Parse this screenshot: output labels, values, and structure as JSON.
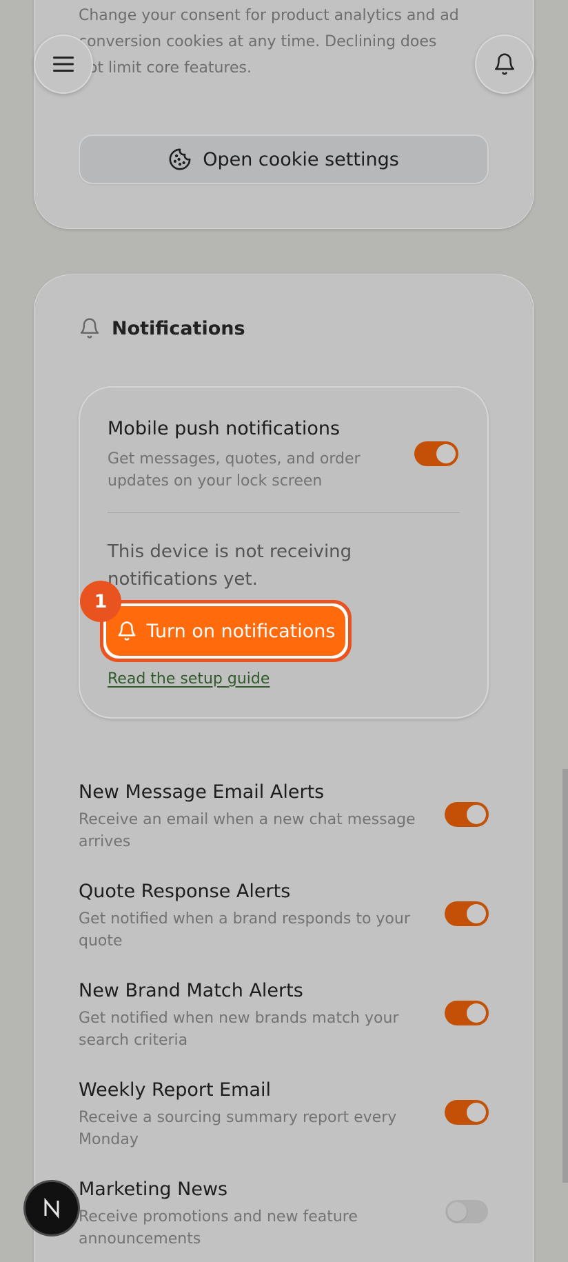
{
  "consent": {
    "text": "Change your consent for product analytics and ad conversion cookies at any time. Declining does not limit core features.",
    "button_label": "Open cookie settings"
  },
  "notifications": {
    "heading": "Notifications",
    "push": {
      "title": "Mobile push notifications",
      "description": "Get messages, quotes, and order updates on your lock screen",
      "enabled": true,
      "status": "This device is not receiving notifications yet.",
      "turn_on_label": "Turn on notifications",
      "guide_link": "Read the setup guide",
      "step_badge": "1"
    },
    "prefs": [
      {
        "title": "New Message Email Alerts",
        "description": "Receive an email when a new chat message arrives",
        "enabled": true
      },
      {
        "title": "Quote Response Alerts",
        "description": "Get notified when a brand responds to your quote",
        "enabled": true
      },
      {
        "title": "New Brand Match Alerts",
        "description": "Get notified when new brands match your search criteria",
        "enabled": true
      },
      {
        "title": "Weekly Report Email",
        "description": "Receive a sourcing summary report every Monday",
        "enabled": true
      },
      {
        "title": "Marketing News",
        "description": "Receive promotions and new feature announcements",
        "enabled": false
      }
    ]
  },
  "colors": {
    "accent": "#ff6a0c",
    "toggle_on": "#c45007",
    "link": "#2f5a2a"
  },
  "icons": [
    "menu-icon",
    "bell-icon",
    "cookie-icon",
    "n-logo"
  ]
}
